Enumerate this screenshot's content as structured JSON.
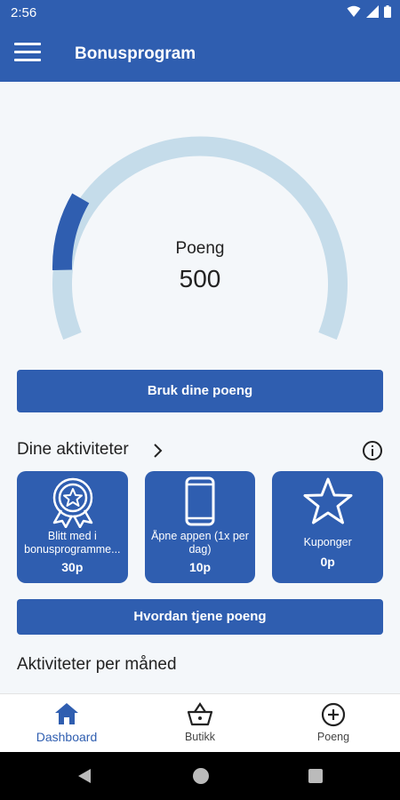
{
  "status_bar": {
    "time": "2:56"
  },
  "app_bar": {
    "title": "Bonusprogram",
    "menu_icon": "hamburger-menu-icon"
  },
  "gauge": {
    "label": "Poeng",
    "value": "500",
    "progress_fraction": 0.13,
    "colors": {
      "track": "#c5dcea",
      "fill": "#2f5eb0"
    }
  },
  "use_points_button": "Bruk dine poeng",
  "activities": {
    "title": "Dine aktiviteter",
    "cards": [
      {
        "icon": "award-ribbon-icon",
        "title": "Blitt med i bonusprogramme...",
        "points": "30p"
      },
      {
        "icon": "phone-icon",
        "title": "Åpne appen (1x per dag)",
        "points": "10p"
      },
      {
        "icon": "star-icon",
        "title": "Kuponger",
        "points": "0p"
      }
    ]
  },
  "earn_points_button": "Hvordan tjene poeng",
  "monthly": {
    "title": "Aktiviteter per måned"
  },
  "bottom_nav": {
    "items": [
      {
        "label": "Dashboard",
        "icon": "home-icon",
        "active": true
      },
      {
        "label": "Butikk",
        "icon": "basket-icon",
        "active": false
      },
      {
        "label": "Poeng",
        "icon": "plus-circle-icon",
        "active": false
      }
    ]
  },
  "colors": {
    "primary": "#2f5eb0",
    "background": "#f4f7fa"
  }
}
